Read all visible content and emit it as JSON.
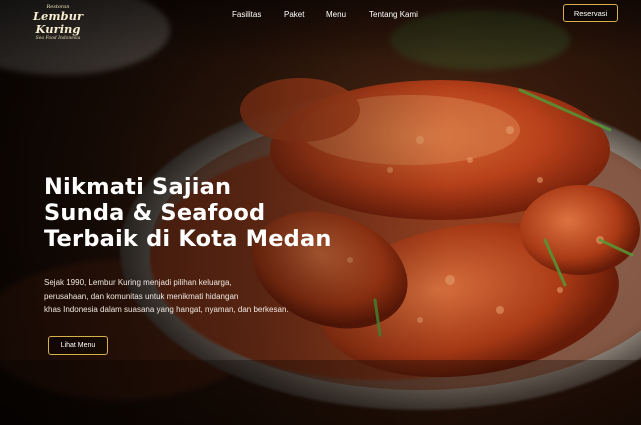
{
  "brand": {
    "logo_top": "Restoran",
    "logo_name": "Lembur Kuring",
    "logo_tagline": "Sea Food Indonesia"
  },
  "nav": {
    "items": [
      "Fasilitas",
      "Paket",
      "Menu",
      "Tentang Kami"
    ],
    "reserve_label": "Reservasi"
  },
  "hero": {
    "headline_lines": [
      "Nikmati Sajian",
      "Sunda & Seafood",
      "Terbaik di Kota Medan"
    ],
    "description_lines": [
      "Sejak 1990, Lembur Kuring menjadi pilihan keluarga,",
      "perusahaan, dan komunitas untuk menikmati hidangan",
      "khas Indonesia dalam suasana yang hangat, nyaman, dan berkesan."
    ],
    "cta_label": "Lihat Menu",
    "background_image": "crab-dish-photo"
  },
  "colors": {
    "accent_border": "#d8b04a",
    "text": "#ffffff"
  }
}
